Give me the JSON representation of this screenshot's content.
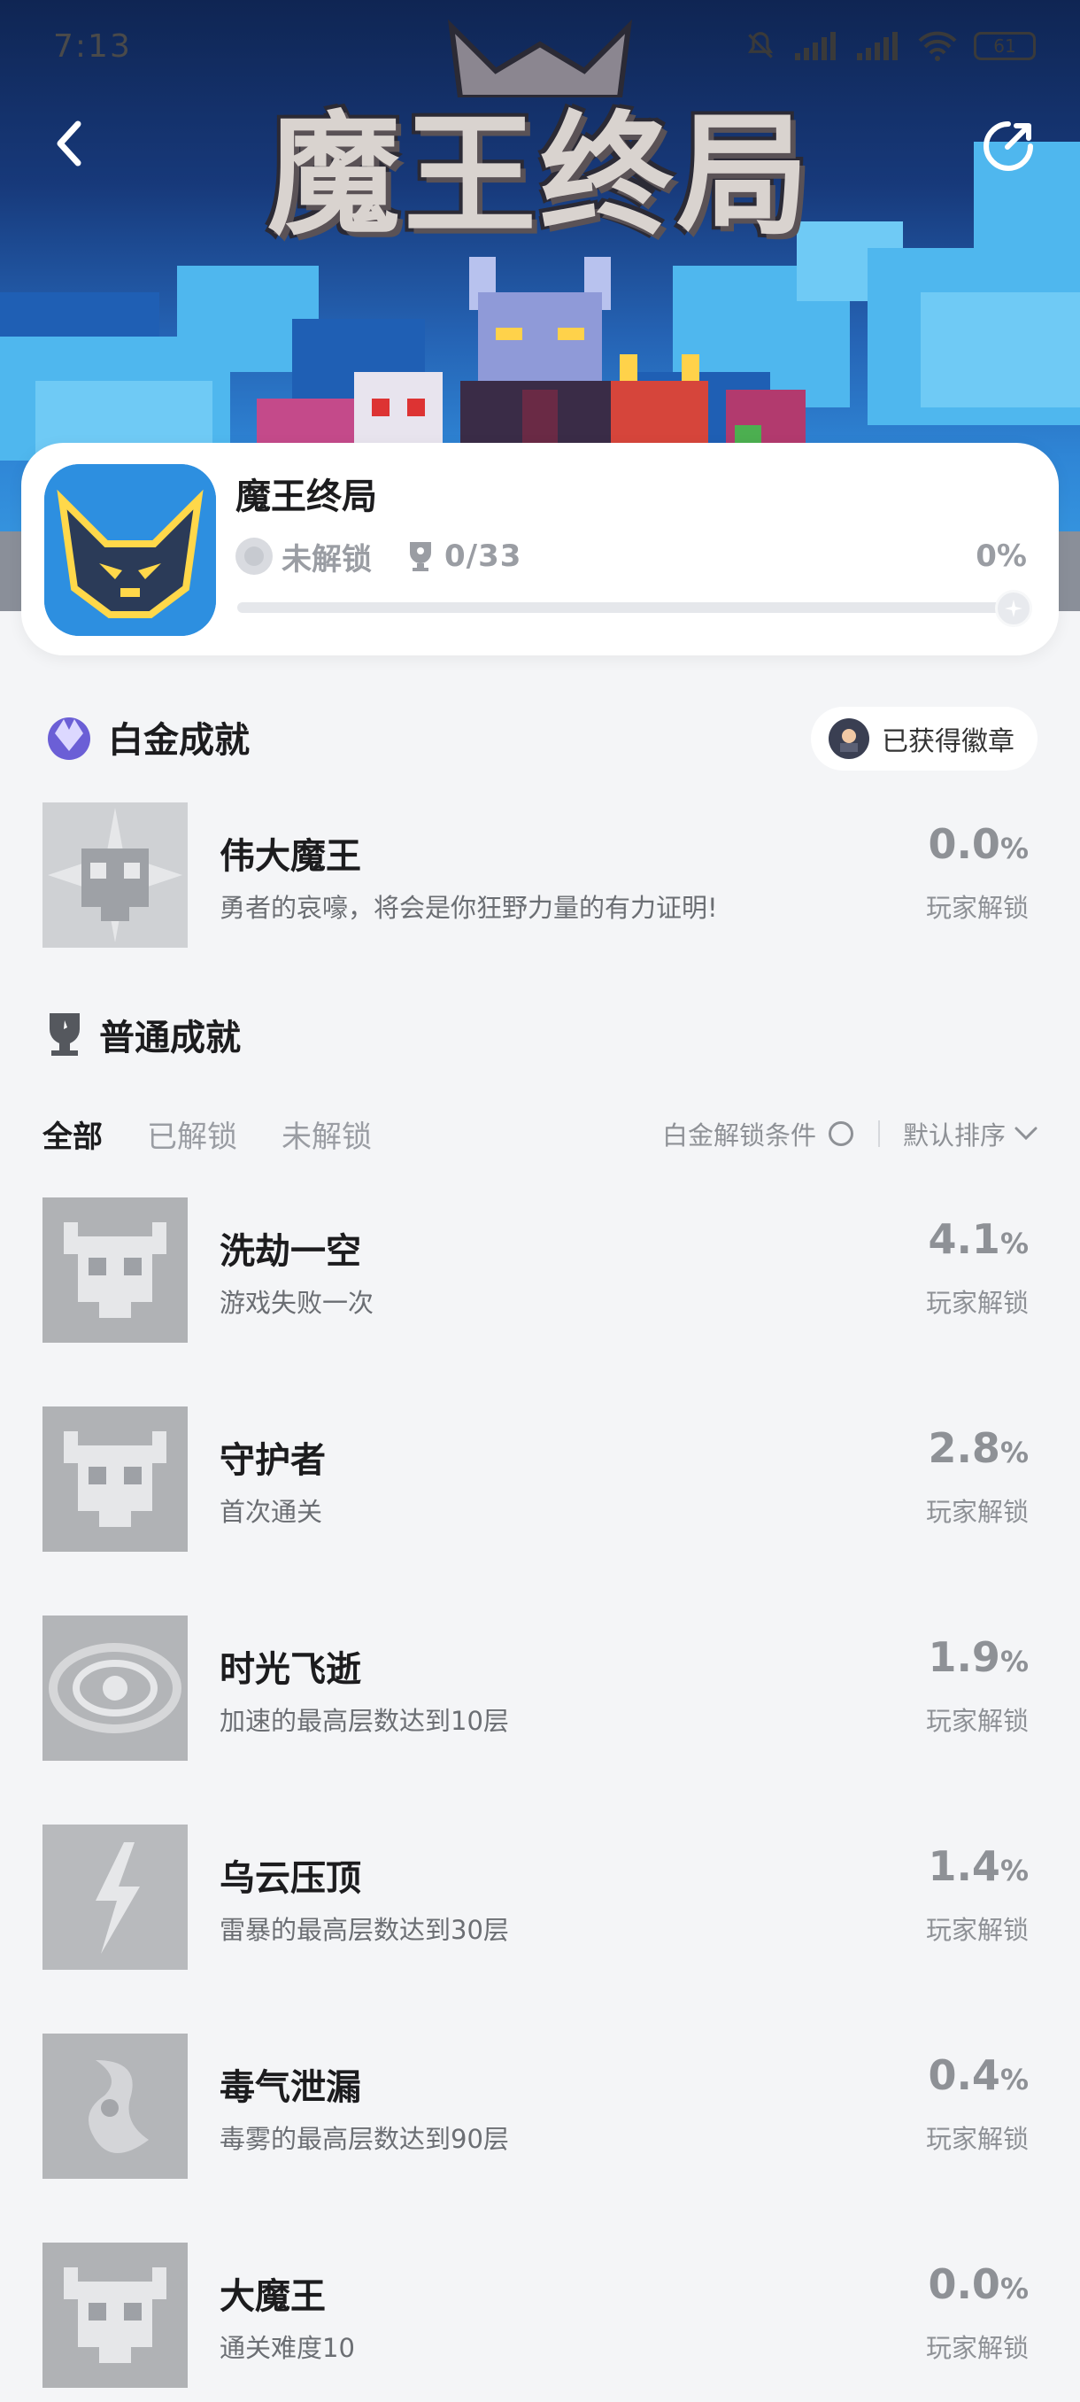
{
  "status_bar": {
    "time": "7:13",
    "battery": "61"
  },
  "header": {
    "hero_title": "魔王终局"
  },
  "game": {
    "name": "魔王终局",
    "lock_status": "未解锁",
    "achievement_count": "0/33",
    "progress_percent": "0%",
    "progress_fraction": 0
  },
  "platinum": {
    "section_title": "白金成就",
    "badge_button": "已获得徽章",
    "item": {
      "name": "伟大魔王",
      "description": "勇者的哀嚎，将会是你狂野力量的有力证明!",
      "percent": "0.0",
      "unit": "%",
      "label": "玩家解锁"
    }
  },
  "normal": {
    "section_title": "普通成就",
    "tabs": [
      "全部",
      "已解锁",
      "未解锁"
    ],
    "condition_label": "白金解锁条件",
    "sort_label": "默认排序",
    "items": [
      {
        "name": "洗劫一空",
        "description": "游戏失败一次",
        "percent": "4.1",
        "unit": "%",
        "label": "玩家解锁"
      },
      {
        "name": "守护者",
        "description": "首次通关",
        "percent": "2.8",
        "unit": "%",
        "label": "玩家解锁"
      },
      {
        "name": "时光飞逝",
        "description": "加速的最高层数达到10层",
        "percent": "1.9",
        "unit": "%",
        "label": "玩家解锁"
      },
      {
        "name": "乌云压顶",
        "description": "雷暴的最高层数达到30层",
        "percent": "1.4",
        "unit": "%",
        "label": "玩家解锁"
      },
      {
        "name": "毒气泄漏",
        "description": "毒雾的最高层数达到90层",
        "percent": "0.4",
        "unit": "%",
        "label": "玩家解锁"
      },
      {
        "name": "大魔王",
        "description": "通关难度10",
        "percent": "0.0",
        "unit": "%",
        "label": "玩家解锁"
      }
    ]
  }
}
